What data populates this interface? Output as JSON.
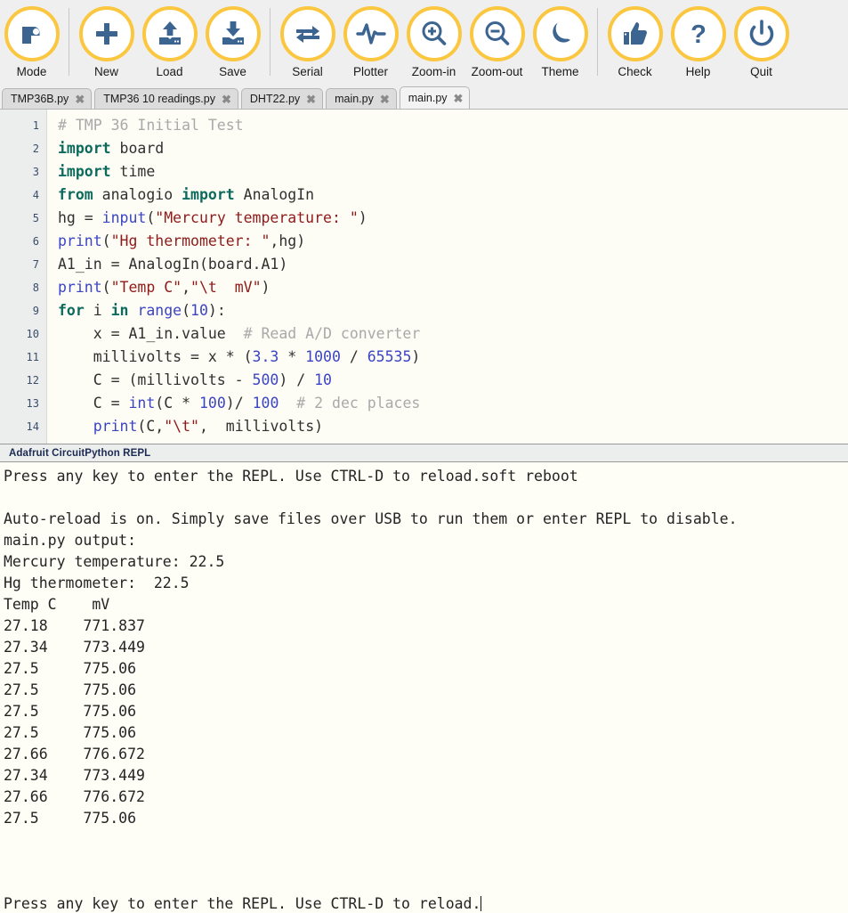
{
  "toolbar": {
    "groups": [
      {
        "buttons": [
          {
            "label": "Mode",
            "icon": "mode-robot-icon"
          }
        ]
      },
      {
        "buttons": [
          {
            "label": "New",
            "icon": "plus-icon"
          },
          {
            "label": "Load",
            "icon": "upload-icon"
          },
          {
            "label": "Save",
            "icon": "download-icon"
          }
        ]
      },
      {
        "buttons": [
          {
            "label": "Serial",
            "icon": "exchange-arrows-icon"
          },
          {
            "label": "Plotter",
            "icon": "waveform-icon"
          },
          {
            "label": "Zoom-in",
            "icon": "magnifier-plus-icon"
          },
          {
            "label": "Zoom-out",
            "icon": "magnifier-minus-icon"
          },
          {
            "label": "Theme",
            "icon": "moon-icon"
          }
        ]
      },
      {
        "buttons": [
          {
            "label": "Check",
            "icon": "thumbs-up-icon"
          },
          {
            "label": "Help",
            "icon": "question-mark-icon"
          },
          {
            "label": "Quit",
            "icon": "power-icon"
          }
        ]
      }
    ],
    "accent_color": "#fbc740",
    "icon_color": "#3c6491",
    "background": "#efefef"
  },
  "tabs": [
    {
      "title": "TMP36B.py",
      "close": "✖",
      "active": false
    },
    {
      "title": "TMP36 10 readings.py",
      "close": "✖",
      "active": false
    },
    {
      "title": "DHT22.py",
      "close": "✖",
      "active": false
    },
    {
      "title": "main.py",
      "close": "✖",
      "active": false
    },
    {
      "title": "main.py",
      "close": "✖",
      "active": true
    }
  ],
  "editor": {
    "line_numbers": [
      "1",
      "2",
      "3",
      "4",
      "5",
      "6",
      "7",
      "8",
      "9",
      "10",
      "11",
      "12",
      "13",
      "14"
    ],
    "lines": [
      [
        {
          "t": "# TMP 36 Initial Test",
          "c": "com"
        }
      ],
      [
        {
          "t": "import",
          "c": "kw"
        },
        {
          "t": " board",
          "c": "def"
        }
      ],
      [
        {
          "t": "import",
          "c": "kw"
        },
        {
          "t": " time",
          "c": "def"
        }
      ],
      [
        {
          "t": "from",
          "c": "kw"
        },
        {
          "t": " analogio ",
          "c": "def"
        },
        {
          "t": "import",
          "c": "kw"
        },
        {
          "t": " AnalogIn",
          "c": "def"
        }
      ],
      [
        {
          "t": "hg = ",
          "c": "def"
        },
        {
          "t": "input",
          "c": "bi"
        },
        {
          "t": "(",
          "c": "pun"
        },
        {
          "t": "\"Mercury temperature: \"",
          "c": "str"
        },
        {
          "t": ")",
          "c": "pun"
        }
      ],
      [
        {
          "t": "print",
          "c": "bi"
        },
        {
          "t": "(",
          "c": "pun"
        },
        {
          "t": "\"Hg thermometer: \"",
          "c": "str"
        },
        {
          "t": ",hg)",
          "c": "def"
        }
      ],
      [
        {
          "t": "A1_in = AnalogIn(board.A1)",
          "c": "def"
        }
      ],
      [
        {
          "t": "print",
          "c": "bi"
        },
        {
          "t": "(",
          "c": "pun"
        },
        {
          "t": "\"Temp C\"",
          "c": "str"
        },
        {
          "t": ",",
          "c": "pun"
        },
        {
          "t": "\"\\t  mV\"",
          "c": "str"
        },
        {
          "t": ")",
          "c": "pun"
        }
      ],
      [
        {
          "t": "for",
          "c": "kw"
        },
        {
          "t": " i ",
          "c": "def"
        },
        {
          "t": "in",
          "c": "kw"
        },
        {
          "t": " ",
          "c": "def"
        },
        {
          "t": "range",
          "c": "bi"
        },
        {
          "t": "(",
          "c": "pun"
        },
        {
          "t": "10",
          "c": "num"
        },
        {
          "t": "):",
          "c": "pun"
        }
      ],
      [
        {
          "t": "    x = A1_in.value  ",
          "c": "def"
        },
        {
          "t": "# Read A/D converter",
          "c": "com"
        }
      ],
      [
        {
          "t": "    millivolts = x * (",
          "c": "def"
        },
        {
          "t": "3.3",
          "c": "num"
        },
        {
          "t": " * ",
          "c": "def"
        },
        {
          "t": "1000",
          "c": "num"
        },
        {
          "t": " / ",
          "c": "def"
        },
        {
          "t": "65535",
          "c": "num"
        },
        {
          "t": ")",
          "c": "def"
        }
      ],
      [
        {
          "t": "    C = (millivolts - ",
          "c": "def"
        },
        {
          "t": "500",
          "c": "num"
        },
        {
          "t": ") / ",
          "c": "def"
        },
        {
          "t": "10",
          "c": "num"
        }
      ],
      [
        {
          "t": "    C = ",
          "c": "def"
        },
        {
          "t": "int",
          "c": "bi"
        },
        {
          "t": "(C * ",
          "c": "def"
        },
        {
          "t": "100",
          "c": "num"
        },
        {
          "t": ")/ ",
          "c": "def"
        },
        {
          "t": "100",
          "c": "num"
        },
        {
          "t": "  ",
          "c": "def"
        },
        {
          "t": "# 2 dec places",
          "c": "com"
        }
      ],
      [
        {
          "t": "    ",
          "c": "def"
        },
        {
          "t": "print",
          "c": "bi"
        },
        {
          "t": "(C,",
          "c": "def"
        },
        {
          "t": "\"\\t\"",
          "c": "str"
        },
        {
          "t": ",  millivolts)",
          "c": "def"
        }
      ]
    ]
  },
  "repl": {
    "title": "Adafruit CircuitPython REPL",
    "lines": [
      "Press any key to enter the REPL. Use CTRL-D to reload.soft reboot",
      "",
      "Auto-reload is on. Simply save files over USB to run them or enter REPL to disable.",
      "main.py output:",
      "Mercury temperature: 22.5",
      "Hg thermometer:  22.5",
      "Temp C    mV",
      "27.18    771.837",
      "27.34    773.449",
      "27.5     775.06",
      "27.5     775.06",
      "27.5     775.06",
      "27.5     775.06",
      "27.66    776.672",
      "27.34    773.449",
      "27.66    776.672",
      "27.5     775.06",
      "",
      "",
      ""
    ],
    "prompt_line": "Press any key to enter the REPL. Use CTRL-D to reload."
  }
}
